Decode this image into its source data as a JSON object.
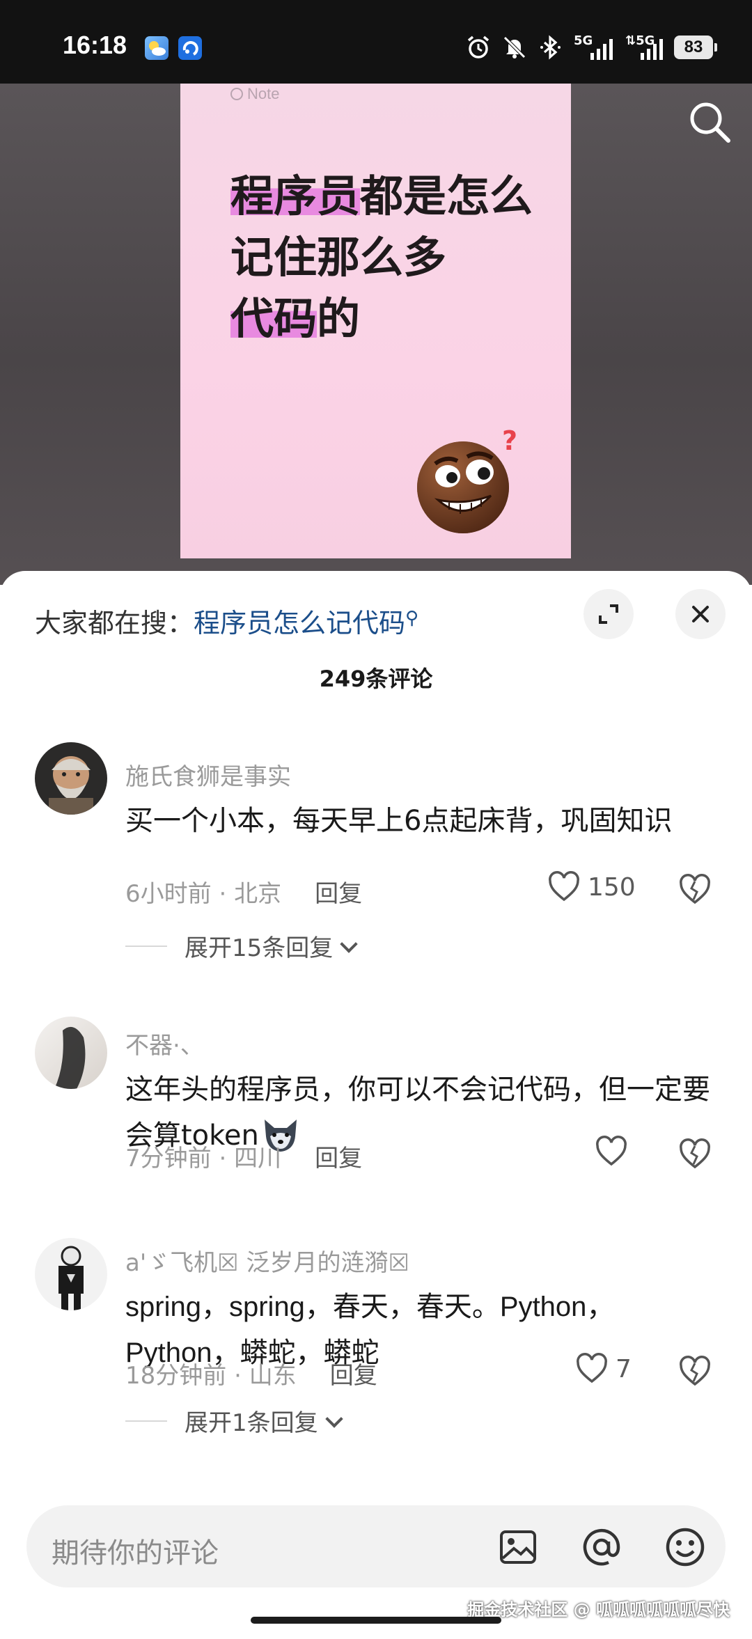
{
  "status_bar": {
    "time": "16:18",
    "battery": "83",
    "signal_1": "5G",
    "signal_2": "5G"
  },
  "video": {
    "note_tag": "Note",
    "title_parts": [
      "程序员",
      "都是怎么记住那么多",
      "代码",
      "的"
    ]
  },
  "hot_search": {
    "prefix": "大家都在搜：",
    "query": "程序员怎么记代码"
  },
  "comment_count": "249条评论",
  "comments": [
    {
      "user": "施氏食狮是事实",
      "text": "买一个小本，每天早上6点起床背，巩固知识",
      "time": "6小时前",
      "location": "北京",
      "reply_label": "回复",
      "likes": "150",
      "expand": "展开15条回复"
    },
    {
      "user": "不器·、",
      "text": "这年头的程序员，你可以不会记代码，但一定要会算token",
      "time": "7分钟前",
      "location": "四川",
      "reply_label": "回复",
      "likes": ""
    },
    {
      "user": "a'ゞ飞机☒ 泛岁月的涟漪☒",
      "text": "spring，spring，春天，春天。Python，Python，蟒蛇，蟒蛇",
      "time": "18分钟前",
      "location": "山东",
      "reply_label": "回复",
      "likes": "7",
      "expand": "展开1条回复"
    }
  ],
  "input": {
    "placeholder": "期待你的评论"
  },
  "watermark": "掘金技术社区 @ 呱呱呱呱呱呱尽快",
  "icons": [
    "alarm-icon",
    "mute-icon",
    "bluetooth-icon",
    "search-icon",
    "expand-icon",
    "close-icon",
    "heart-icon",
    "broken-heart-icon",
    "image-icon",
    "at-icon",
    "emoji-icon"
  ],
  "colors": {
    "link": "#1b4e8a",
    "highlight": "#e88ae0",
    "sheet": "#ffffff"
  }
}
